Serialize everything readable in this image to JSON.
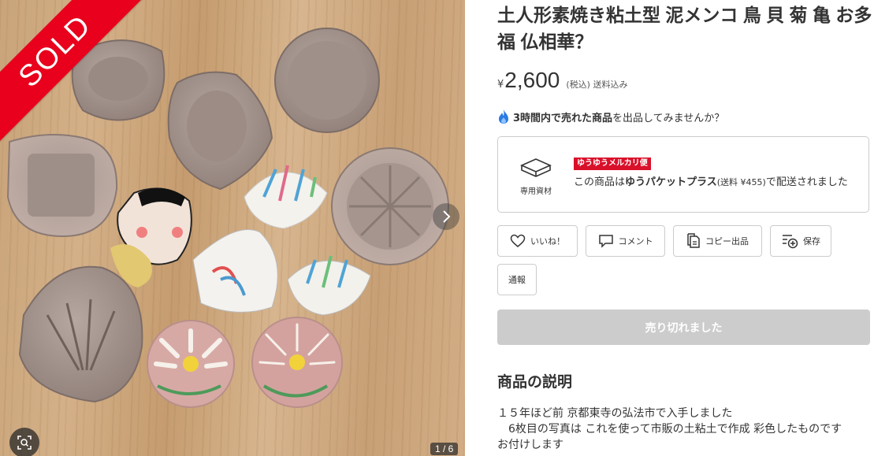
{
  "gallery": {
    "sold_label": "SOLD",
    "counter": "1 / 6",
    "next_icon": "chevron-right-icon",
    "zoom_icon": "zoom-scan-icon"
  },
  "item": {
    "title": "土人形素焼き粘土型 泥メンコ 鳥 貝 菊 亀 お多福 仏相華？",
    "currency_symbol": "¥",
    "price": "2,600",
    "tax_note": "(税込) 送料込み"
  },
  "promo": {
    "bold": "3時間内で売れた商品",
    "rest": "を出品してみませんか？",
    "icon": "fire-icon"
  },
  "shipping": {
    "icon_label": "専用資材",
    "badge": "ゆうゆうメルカリ便",
    "desc_prefix": "この商品は",
    "desc_service": "ゆうパケットプラス",
    "desc_fee": "(送料 ¥455)",
    "desc_suffix": "で配送されました"
  },
  "actions": {
    "like": "いいね！",
    "comment": "コメント",
    "copy": "コピー出品",
    "save": "保存",
    "report": "通報"
  },
  "purchase": {
    "soldout_label": "売り切れました"
  },
  "description": {
    "heading": "商品の説明",
    "body": "１５年ほど前 京都東寺の弘法市で入手しました\n　6枚目の写真は これを使って市販の土粘土で作成 彩色したものです\nお付けします"
  },
  "colors": {
    "sold_red": "#e8001c",
    "badge_red": "#d9102a",
    "soldout_gray": "#cccccc",
    "fire_blue": "#2b7be4"
  }
}
